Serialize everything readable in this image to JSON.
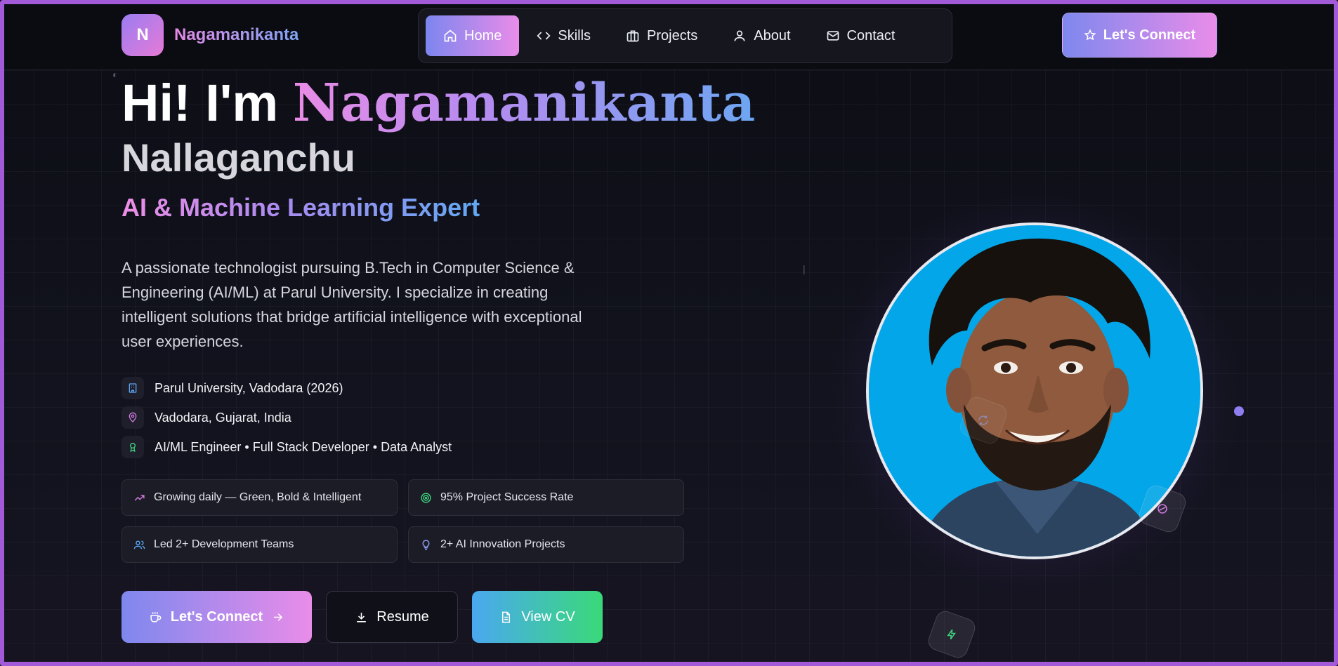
{
  "brand": {
    "initial": "N",
    "name": "Nagamanikanta"
  },
  "nav": {
    "items": [
      {
        "label": "Home",
        "icon": "home-icon",
        "active": true
      },
      {
        "label": "Skills",
        "icon": "code-icon",
        "active": false
      },
      {
        "label": "Projects",
        "icon": "briefcase-icon",
        "active": false
      },
      {
        "label": "About",
        "icon": "user-icon",
        "active": false
      },
      {
        "label": "Contact",
        "icon": "mail-icon",
        "active": false
      }
    ],
    "cta": "Let's Connect"
  },
  "hero": {
    "greeting": "Hi! I'm",
    "first_name": "Nagamanikanta",
    "last_name": "Nallaganchu",
    "role": "AI & Machine Learning Expert",
    "description": "A passionate technologist pursuing B.Tech in Computer Science & Engineering (AI/ML) at Parul University. I specialize in creating intelligent solutions that bridge artificial intelligence with exceptional user experiences."
  },
  "facts": [
    {
      "text": "Parul University, Vadodara (2026)",
      "icon": "building-icon",
      "color": "#5aa6f2"
    },
    {
      "text": "Vadodara, Gujarat, India",
      "icon": "map-pin-icon",
      "color": "#d27be0"
    },
    {
      "text": "AI/ML Engineer • Full Stack Developer • Data Analyst",
      "icon": "award-icon",
      "color": "#3fd17d"
    }
  ],
  "stats": [
    {
      "text": "Growing daily — Green, Bold & Intelligent",
      "icon": "trending-up-icon",
      "color": "#d27be0"
    },
    {
      "text": "95% Project Success Rate",
      "icon": "target-icon",
      "color": "#3fd17d"
    },
    {
      "text": "Led 2+ Development Teams",
      "icon": "users-icon",
      "color": "#5aa6f2"
    },
    {
      "text": "2+ AI Innovation Projects",
      "icon": "lightbulb-icon",
      "color": "#8e9cf0"
    }
  ],
  "actions": {
    "connect": "Let's Connect",
    "resume": "Resume",
    "view_cv": "View CV"
  },
  "colors": {
    "accent_gradient_start": "#7e88ee",
    "accent_gradient_end": "#e98ce9",
    "green": "#3ad97a",
    "frame": "#a35ad8"
  }
}
